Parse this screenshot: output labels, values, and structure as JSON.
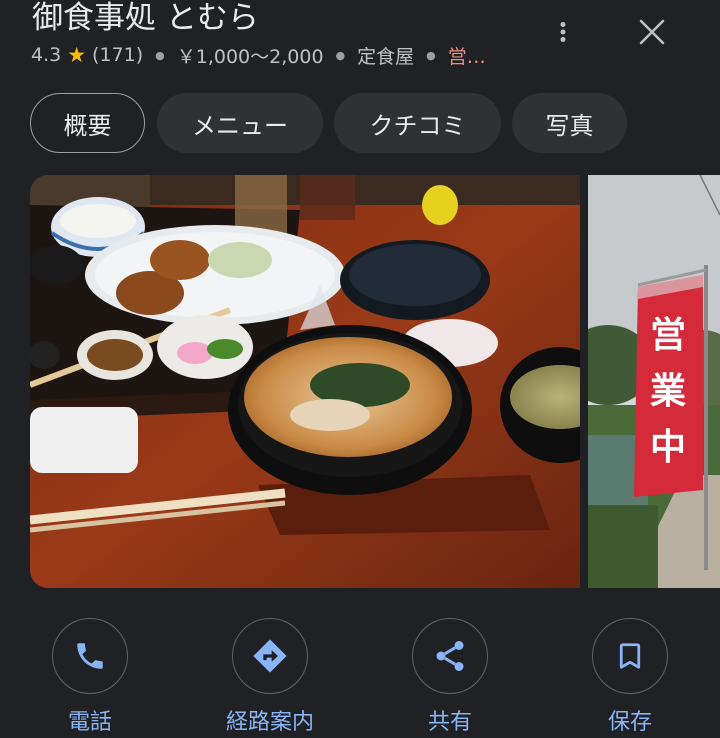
{
  "place": {
    "name": "御食事処 とむら",
    "rating": "4.3",
    "review_count": "(171)",
    "price_range": "￥1,000〜2,000",
    "category": "定食屋",
    "status": "営…",
    "star_icon": "star-icon"
  },
  "header": {
    "more_icon": "more-vert-icon",
    "close_icon": "close-icon"
  },
  "tabs": [
    {
      "label": "概要",
      "active": true
    },
    {
      "label": "メニュー",
      "active": false
    },
    {
      "label": "クチコミ",
      "active": false
    },
    {
      "label": "写真",
      "active": false
    }
  ],
  "photos": {
    "sign_text": "営業中"
  },
  "actions": [
    {
      "label": "電話",
      "icon": "phone-icon"
    },
    {
      "label": "経路案内",
      "icon": "directions-icon"
    },
    {
      "label": "共有",
      "icon": "share-icon"
    },
    {
      "label": "保存",
      "icon": "bookmark-icon"
    }
  ],
  "colors": {
    "background": "#202124",
    "accent": "#8ab4f8",
    "star": "#fbbc04",
    "open_status": "#f28b82"
  }
}
